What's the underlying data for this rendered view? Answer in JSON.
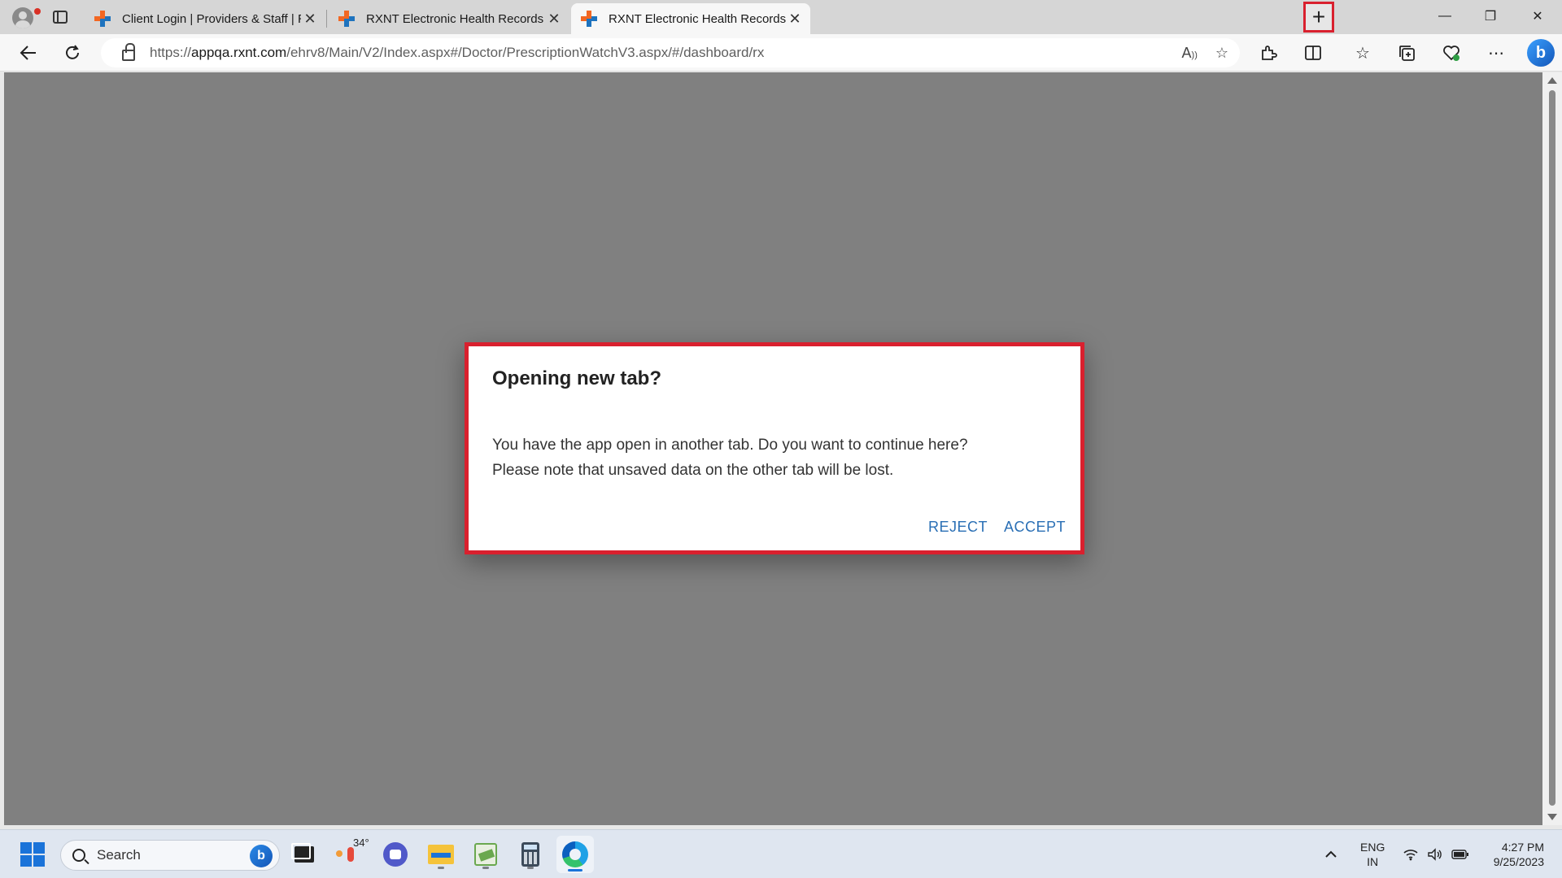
{
  "browser": {
    "tabs": [
      {
        "title": "Client Login | Providers & Staff | RXNT",
        "active": false
      },
      {
        "title": "RXNT Electronic Health Records",
        "active": false
      },
      {
        "title": "RXNT Electronic Health Records",
        "active": true
      }
    ],
    "new_tab_symbol": "+",
    "window_controls": {
      "minimize": "—",
      "restore": "❐",
      "close": "✕"
    },
    "address": {
      "url_prefix": "https://",
      "url_host": "appqa.rxnt.com",
      "url_path": "/ehrv8/Main/V2/Index.aspx#/Doctor/PrescriptionWatchV3.aspx/#/dashboard/rx"
    },
    "toolbar_icons": [
      "back-icon",
      "refresh-icon",
      "lock-icon",
      "read-aloud-icon",
      "favorite-star-icon",
      "extensions-icon",
      "split-screen-icon",
      "favorites-icon",
      "collections-icon",
      "browser-essentials-icon",
      "more-icon",
      "bing-copilot-icon"
    ]
  },
  "dialog": {
    "title": "Opening new tab?",
    "body_line1": "You have the app open in another tab. Do you want to continue here?",
    "body_line2": "Please note that unsaved data on the other tab will be lost.",
    "reject_label": "REJECT",
    "accept_label": "ACCEPT"
  },
  "taskbar": {
    "search_placeholder": "Search",
    "weather_temp": "34°",
    "language": "ENG",
    "region": "IN",
    "time": "4:27 PM",
    "date": "9/25/2023"
  },
  "colors": {
    "highlight_border": "#d9202e",
    "dialog_button": "#2a6fb5",
    "overlay": "#808080"
  }
}
